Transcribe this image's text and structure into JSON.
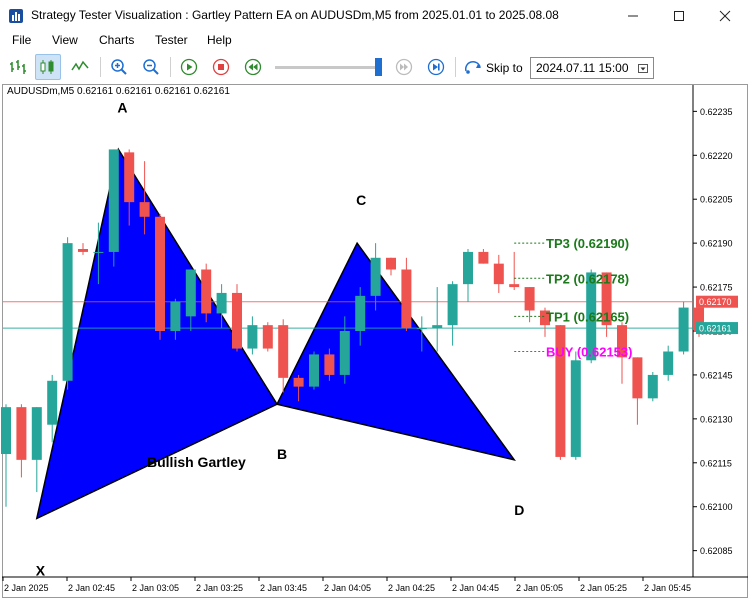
{
  "window": {
    "title": "Strategy Tester Visualization : Gartley Pattern EA on AUDUSDm,M5 from 2025.01.01 to 2025.08.08",
    "minimize_icon": "minimize-icon",
    "maximize_icon": "maximize-icon",
    "close_icon": "close-icon"
  },
  "menu": {
    "items": [
      "File",
      "View",
      "Charts",
      "Tester",
      "Help"
    ]
  },
  "toolbar": {
    "icons": [
      "bar-chart-icon",
      "candlestick-icon",
      "line-chart-icon",
      "zoom-in-icon",
      "zoom-out-icon",
      "play-icon",
      "stop-icon",
      "rewind-icon",
      "step-forward-icon",
      "skip-to-end-icon",
      "skip-to-icon"
    ],
    "skip_label": "Skip to",
    "skip_date": "2024.07.11 15:00"
  },
  "chart": {
    "symbol_info": "AUDUSDm,M5  0.62161 0.62161 0.62161 0.62161",
    "colors": {
      "bull": "#26a69a",
      "bear": "#ef5350",
      "pattern_fill": "#0000ff",
      "tp": "#1a7a1a",
      "buy": "#ff00ff",
      "bid_line": "#26a69a",
      "ask_line": "#ef5350"
    },
    "price_range": [
      0.62076,
      0.62244
    ],
    "y_ticks": [
      "0.62235",
      "0.62220",
      "0.62205",
      "0.62190",
      "0.62175",
      "0.62160",
      "0.62145",
      "0.62130",
      "0.62115",
      "0.62100",
      "0.62085"
    ],
    "x_ticks": [
      "2 Jan 2025",
      "2 Jan 02:45",
      "2 Jan 03:05",
      "2 Jan 03:25",
      "2 Jan 03:45",
      "2 Jan 04:05",
      "2 Jan 04:25",
      "2 Jan 04:45",
      "2 Jan 05:05",
      "2 Jan 05:25",
      "2 Jan 05:45"
    ],
    "ask_price": "0.62170",
    "bid_price": "0.62161",
    "pattern": {
      "name": "Bullish Gartley",
      "points": {
        "X": {
          "label": "X",
          "price": 0.62096
        },
        "A": {
          "label": "A",
          "price": 0.62222
        },
        "B": {
          "label": "B",
          "price": 0.62135
        },
        "C": {
          "label": "C",
          "price": 0.6219
        },
        "D": {
          "label": "D",
          "price": 0.62116
        }
      }
    },
    "levels": [
      {
        "label": "TP3 (0.62190)",
        "price": 0.6219,
        "type": "tp"
      },
      {
        "label": "TP2 (0.62178)",
        "price": 0.62178,
        "type": "tp"
      },
      {
        "label": "TP1 (0.62165)",
        "price": 0.62165,
        "type": "tp"
      },
      {
        "label": "BUY (0.62153)",
        "price": 0.62153,
        "type": "buy"
      }
    ],
    "candles": [
      {
        "o": 0.62118,
        "h": 0.62135,
        "l": 0.621,
        "c": 0.62134
      },
      {
        "o": 0.62134,
        "h": 0.62135,
        "l": 0.6211,
        "c": 0.62116
      },
      {
        "o": 0.62116,
        "h": 0.62134,
        "l": 0.62105,
        "c": 0.62134
      },
      {
        "o": 0.62128,
        "h": 0.62145,
        "l": 0.62122,
        "c": 0.62143
      },
      {
        "o": 0.62143,
        "h": 0.62192,
        "l": 0.6214,
        "c": 0.6219
      },
      {
        "o": 0.62188,
        "h": 0.6219,
        "l": 0.62186,
        "c": 0.62187
      },
      {
        "o": 0.62187,
        "h": 0.62197,
        "l": 0.62176,
        "c": 0.62187
      },
      {
        "o": 0.62187,
        "h": 0.62222,
        "l": 0.62182,
        "c": 0.62222
      },
      {
        "o": 0.62221,
        "h": 0.62222,
        "l": 0.62196,
        "c": 0.62204
      },
      {
        "o": 0.62204,
        "h": 0.62218,
        "l": 0.62193,
        "c": 0.62199
      },
      {
        "o": 0.62199,
        "h": 0.622,
        "l": 0.62157,
        "c": 0.6216
      },
      {
        "o": 0.6216,
        "h": 0.62171,
        "l": 0.62157,
        "c": 0.6217
      },
      {
        "o": 0.62165,
        "h": 0.6218,
        "l": 0.6216,
        "c": 0.62181
      },
      {
        "o": 0.62181,
        "h": 0.62183,
        "l": 0.62163,
        "c": 0.62166
      },
      {
        "o": 0.62166,
        "h": 0.62176,
        "l": 0.62161,
        "c": 0.62173
      },
      {
        "o": 0.62173,
        "h": 0.62176,
        "l": 0.62153,
        "c": 0.62154
      },
      {
        "o": 0.62154,
        "h": 0.62165,
        "l": 0.62152,
        "c": 0.62162
      },
      {
        "o": 0.62162,
        "h": 0.62163,
        "l": 0.62153,
        "c": 0.62154
      },
      {
        "o": 0.62162,
        "h": 0.62164,
        "l": 0.62139,
        "c": 0.62144
      },
      {
        "o": 0.62144,
        "h": 0.62145,
        "l": 0.62136,
        "c": 0.62141
      },
      {
        "o": 0.62141,
        "h": 0.62153,
        "l": 0.6214,
        "c": 0.62152
      },
      {
        "o": 0.62152,
        "h": 0.62154,
        "l": 0.62143,
        "c": 0.62145
      },
      {
        "o": 0.62145,
        "h": 0.62165,
        "l": 0.62142,
        "c": 0.6216
      },
      {
        "o": 0.6216,
        "h": 0.62175,
        "l": 0.62155,
        "c": 0.62172
      },
      {
        "o": 0.62172,
        "h": 0.6219,
        "l": 0.62167,
        "c": 0.62185
      },
      {
        "o": 0.62185,
        "h": 0.62185,
        "l": 0.62179,
        "c": 0.62181
      },
      {
        "o": 0.62181,
        "h": 0.62185,
        "l": 0.6216,
        "c": 0.62161
      },
      {
        "o": 0.62161,
        "h": 0.62165,
        "l": 0.62153,
        "c": 0.62161
      },
      {
        "o": 0.62161,
        "h": 0.62175,
        "l": 0.62153,
        "c": 0.62162
      },
      {
        "o": 0.62162,
        "h": 0.62177,
        "l": 0.62155,
        "c": 0.62176
      },
      {
        "o": 0.62176,
        "h": 0.62188,
        "l": 0.6217,
        "c": 0.62187
      },
      {
        "o": 0.62187,
        "h": 0.62188,
        "l": 0.62183,
        "c": 0.62183
      },
      {
        "o": 0.62183,
        "h": 0.62186,
        "l": 0.62173,
        "c": 0.62176
      },
      {
        "o": 0.62176,
        "h": 0.62187,
        "l": 0.62174,
        "c": 0.62175
      },
      {
        "o": 0.62175,
        "h": 0.62175,
        "l": 0.62163,
        "c": 0.62167
      },
      {
        "o": 0.62167,
        "h": 0.62168,
        "l": 0.62158,
        "c": 0.62162
      },
      {
        "o": 0.62162,
        "h": 0.62162,
        "l": 0.62116,
        "c": 0.62117
      },
      {
        "o": 0.62117,
        "h": 0.62153,
        "l": 0.62116,
        "c": 0.6215
      },
      {
        "o": 0.6215,
        "h": 0.62181,
        "l": 0.62149,
        "c": 0.6218
      },
      {
        "o": 0.6218,
        "h": 0.6218,
        "l": 0.62158,
        "c": 0.62162
      },
      {
        "o": 0.62162,
        "h": 0.62163,
        "l": 0.62142,
        "c": 0.62151
      },
      {
        "o": 0.62151,
        "h": 0.62151,
        "l": 0.62128,
        "c": 0.62137
      },
      {
        "o": 0.62137,
        "h": 0.62146,
        "l": 0.62136,
        "c": 0.62145
      },
      {
        "o": 0.62145,
        "h": 0.62155,
        "l": 0.62143,
        "c": 0.62153
      },
      {
        "o": 0.62153,
        "h": 0.6217,
        "l": 0.62152,
        "c": 0.62168
      },
      {
        "o": 0.62168,
        "h": 0.62172,
        "l": 0.62158,
        "c": 0.6216
      }
    ]
  }
}
